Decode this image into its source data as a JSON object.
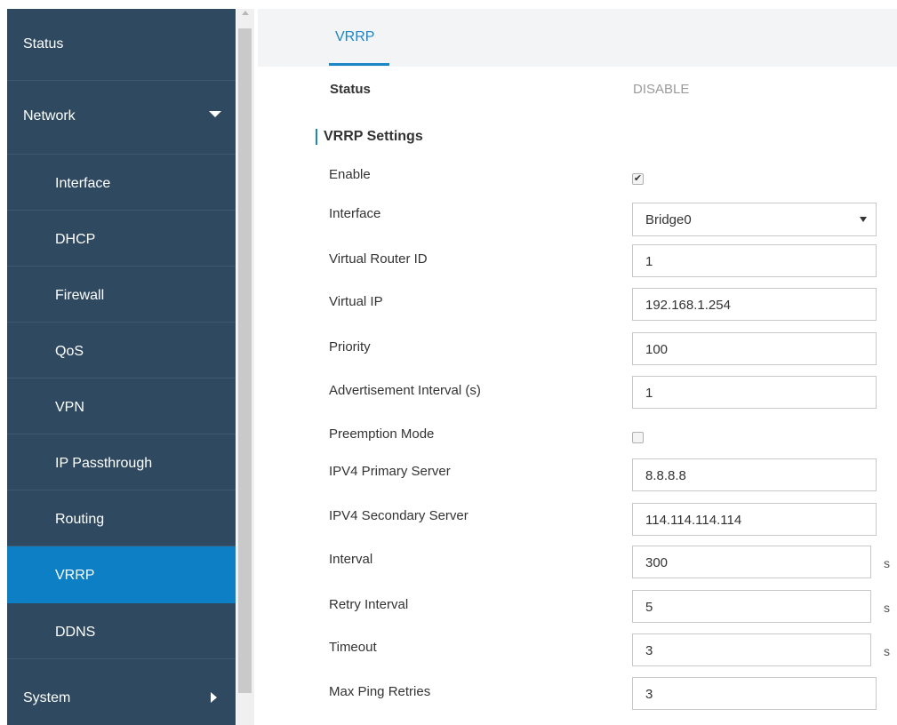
{
  "sidebar": {
    "items": [
      {
        "label": "Status"
      },
      {
        "label": "Network"
      },
      {
        "label": "Interface"
      },
      {
        "label": "DHCP"
      },
      {
        "label": "Firewall"
      },
      {
        "label": "QoS"
      },
      {
        "label": "VPN"
      },
      {
        "label": "IP Passthrough"
      },
      {
        "label": "Routing"
      },
      {
        "label": "VRRP"
      },
      {
        "label": "DDNS"
      },
      {
        "label": "System"
      }
    ],
    "active_item": "VRRP"
  },
  "tabs": [
    {
      "label": "VRRP"
    }
  ],
  "status": {
    "label": "Status",
    "value": "DISABLE"
  },
  "section": {
    "title": "VRRP Settings"
  },
  "form": {
    "enable": {
      "label": "Enable",
      "checked": true
    },
    "interface": {
      "label": "Interface",
      "value": "Bridge0"
    },
    "virtual_router_id": {
      "label": "Virtual Router ID",
      "value": "1"
    },
    "virtual_ip": {
      "label": "Virtual IP",
      "value": "192.168.1.254"
    },
    "priority": {
      "label": "Priority",
      "value": "100"
    },
    "advertisement_interval": {
      "label": "Advertisement Interval (s)",
      "value": "1"
    },
    "preemption_mode": {
      "label": "Preemption Mode",
      "checked": false
    },
    "ipv4_primary": {
      "label": "IPV4 Primary Server",
      "value": "8.8.8.8"
    },
    "ipv4_secondary": {
      "label": "IPV4 Secondary Server",
      "value": "114.114.114.114"
    },
    "interval": {
      "label": "Interval",
      "value": "300",
      "unit": "s"
    },
    "retry_interval": {
      "label": "Retry Interval",
      "value": "5",
      "unit": "s"
    },
    "timeout": {
      "label": "Timeout",
      "value": "3",
      "unit": "s"
    },
    "max_ping_retries": {
      "label": "Max Ping Retries",
      "value": "3"
    }
  },
  "colors": {
    "sidebar_bg": "#2f4a60",
    "active_item_bg": "#0d7fc4",
    "accent": "#1a86c6",
    "status_value": "#9a9a9a"
  },
  "icons": {
    "network_expand": "caret-down-icon",
    "system_expand": "caret-right-icon",
    "enable_checkbox": "checkmark-icon"
  }
}
